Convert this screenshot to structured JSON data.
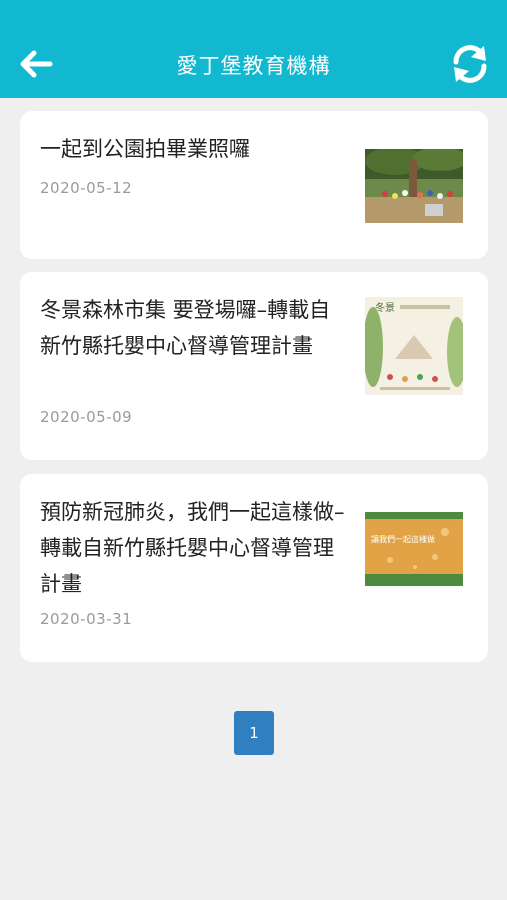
{
  "header": {
    "title": "愛丁堡教育機構",
    "back_icon": "arrow-left-icon",
    "refresh_icon": "refresh-icon",
    "bar_color": "#12b8cf"
  },
  "articles": [
    {
      "title": "一起到公園拍畢業照囉",
      "date": "2020-05-12",
      "thumbnail": "park-group-photo"
    },
    {
      "title": "冬景森林市集 要登場囉–轉載自新竹縣托嬰中心督導管理計畫",
      "date": "2020-05-09",
      "thumbnail": "forest-market-poster"
    },
    {
      "title": "預防新冠肺炎，我們一起這樣做–轉載自新竹縣托嬰中心督導管理計畫",
      "date": "2020-03-31",
      "thumbnail": "covid-prevention-poster"
    }
  ],
  "thumbnail_texts": {
    "poster2_heading": "冬景",
    "poster3_banner": "讓我們一起這樣做"
  },
  "pagination": {
    "current": "1",
    "color": "#2f7fc1"
  }
}
